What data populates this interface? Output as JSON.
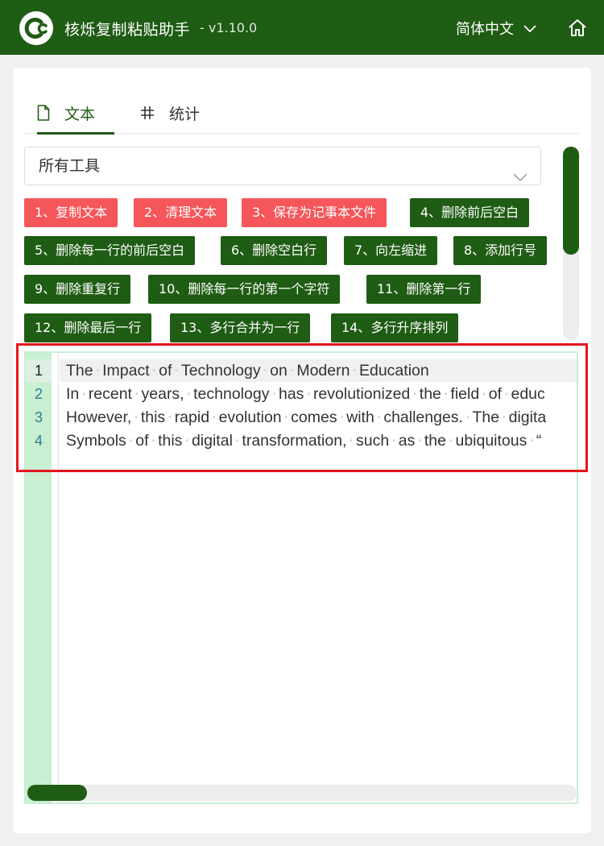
{
  "titlebar": {
    "app_name": "核烁复制粘贴助手",
    "version": "- v1.10.0",
    "language": "简体中文"
  },
  "tabs": [
    {
      "label": "文本"
    },
    {
      "label": "统计"
    }
  ],
  "tools_dropdown": {
    "value": "所有工具"
  },
  "tool_buttons": [
    {
      "label": "1、复制文本",
      "color": "#f4565a"
    },
    {
      "label": "2、清理文本",
      "color": "#f4565a"
    },
    {
      "label": "3、保存为记事本文件",
      "color": "#f4565a"
    },
    {
      "label": "4、删除前后空白",
      "color": "#1f5c14"
    },
    {
      "label": "5、删除每一行的前后空白",
      "color": "#1f5c14"
    },
    {
      "label": "6、删除空白行",
      "color": "#1f5c14"
    },
    {
      "label": "7、向左缩进",
      "color": "#1f5c14"
    },
    {
      "label": "8、添加行号",
      "color": "#1f5c14"
    },
    {
      "label": "9、删除重复行",
      "color": "#1f5c14"
    },
    {
      "label": "10、删除每一行的第一个字符",
      "color": "#1f5c14"
    },
    {
      "label": "11、删除第一行",
      "color": "#1f5c14"
    },
    {
      "label": "12、删除最后一行",
      "color": "#1f5c14"
    },
    {
      "label": "13、多行合并为一行",
      "color": "#1f5c14"
    },
    {
      "label": "14、多行升序排列",
      "color": "#1f5c14"
    }
  ],
  "editor": {
    "lines": [
      {
        "num": "1",
        "text": "The Impact of Technology on Modern Education"
      },
      {
        "num": "2",
        "text": "In recent years, technology has revolutionized the field of educ"
      },
      {
        "num": "3",
        "text": "However, this rapid evolution comes with challenges. The digita"
      },
      {
        "num": "4",
        "text": "Symbols of this digital transformation, such as the ubiquitous “"
      }
    ],
    "active_line": 1
  },
  "colors": {
    "brand_green": "#1f5c14",
    "accent_red": "#f4565a",
    "gutter_green": "#c8efd2",
    "highlight_red": "#e3161c"
  }
}
